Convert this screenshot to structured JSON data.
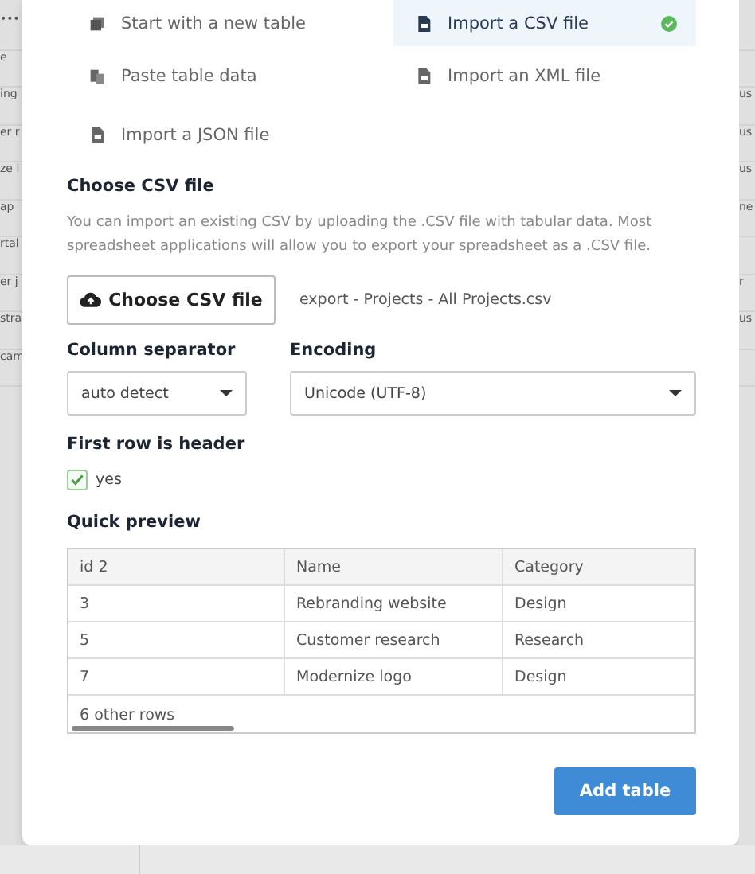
{
  "background_rows": [
    {
      "left": "•••",
      "right": ""
    },
    {
      "left": "e",
      "right": ""
    },
    {
      "left": "ing",
      "right": "us"
    },
    {
      "left": "er r",
      "right": "us"
    },
    {
      "left": "ze l",
      "right": "us"
    },
    {
      "left": "ap",
      "right": "ne"
    },
    {
      "left": "rtal",
      "right": ""
    },
    {
      "left": "er j",
      "right": "r"
    },
    {
      "left": "stra",
      "right": "us"
    },
    {
      "left": "cam",
      "right": ""
    }
  ],
  "import_options": [
    {
      "kind": "new",
      "label": "Start with a new table",
      "selected": false
    },
    {
      "kind": "csv",
      "label": "Import a CSV file",
      "selected": true
    },
    {
      "kind": "paste",
      "label": "Paste table data",
      "selected": false
    },
    {
      "kind": "xml",
      "label": "Import an XML file",
      "selected": false
    },
    {
      "kind": "json",
      "label": "Import a JSON file",
      "selected": false
    }
  ],
  "choose_file": {
    "heading": "Choose CSV file",
    "description": "You can import an existing CSV by uploading the .CSV file with tabular data. Most spreadsheet applications will allow you to export your spreadsheet as a .CSV file.",
    "button": "Choose CSV file",
    "file_name": "export - Projects - All Projects.csv"
  },
  "column_separator": {
    "label": "Column separator",
    "value": "auto detect"
  },
  "encoding": {
    "label": "Encoding",
    "value": "Unicode (UTF-8)"
  },
  "first_row_header": {
    "label": "First row is header",
    "option": "yes",
    "checked": true
  },
  "preview": {
    "heading": "Quick preview",
    "columns": [
      "id 2",
      "Name",
      "Category"
    ],
    "rows": [
      [
        "3",
        "Rebranding website",
        "Design"
      ],
      [
        "5",
        "Customer research",
        "Research"
      ],
      [
        "7",
        "Modernize logo",
        "Design"
      ]
    ],
    "footer": "6 other rows"
  },
  "submit": "Add table"
}
